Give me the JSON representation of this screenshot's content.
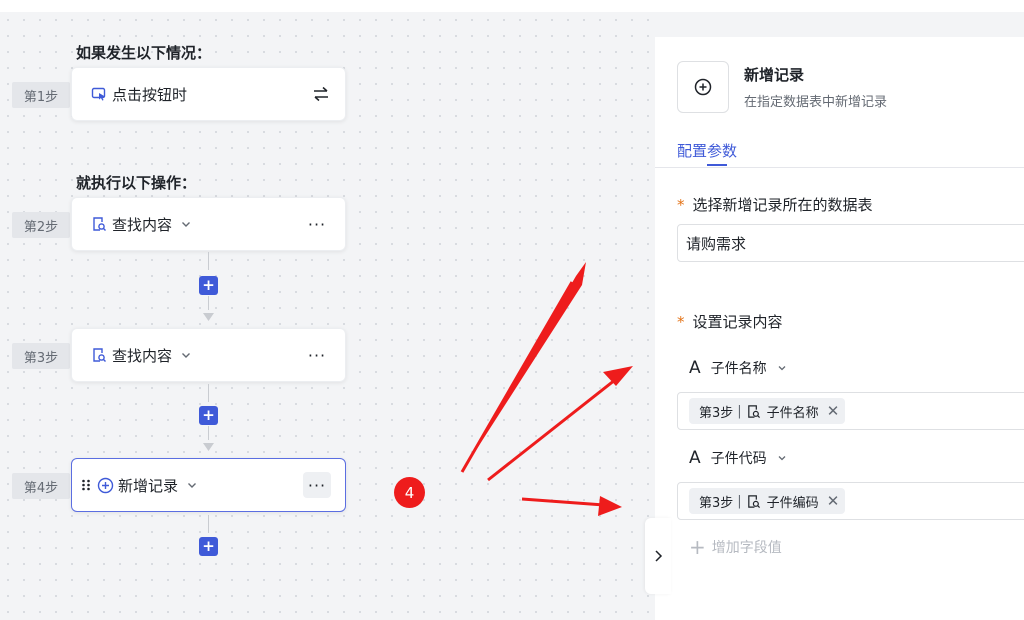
{
  "flow": {
    "trigger_title": "如果发生以下情况：",
    "action_title": "就执行以下操作：",
    "steps": [
      {
        "label": "第1步",
        "text": "点击按钮时"
      },
      {
        "label": "第2步",
        "text": "查找内容"
      },
      {
        "label": "第3步",
        "text": "查找内容"
      },
      {
        "label": "第4步",
        "text": "新增记录"
      }
    ],
    "more": "···",
    "plus": "+"
  },
  "annotation": {
    "badge": "4"
  },
  "panel": {
    "title": "新增记录",
    "subtitle": "在指定数据表中新增记录",
    "tab": "配置参数",
    "table_label": "选择新增记录所在的数据表",
    "table_value": "请购需求",
    "content_label": "设置记录内容",
    "star": "*",
    "fields": [
      {
        "name": "子件名称",
        "tag_step": "第3步",
        "tag_sep": "|",
        "tag_value": "子件名称"
      },
      {
        "name": "子件代码",
        "tag_step": "第3步",
        "tag_sep": "|",
        "tag_value": "子件编码"
      }
    ],
    "field_type_glyph": "A",
    "remove_glyph": "✕",
    "add_field": "增加字段值",
    "add_glyph": "+"
  },
  "colors": {
    "accent": "#3f5ad8",
    "annotation_red": "#ee1c1c",
    "required_star": "#e37318"
  }
}
